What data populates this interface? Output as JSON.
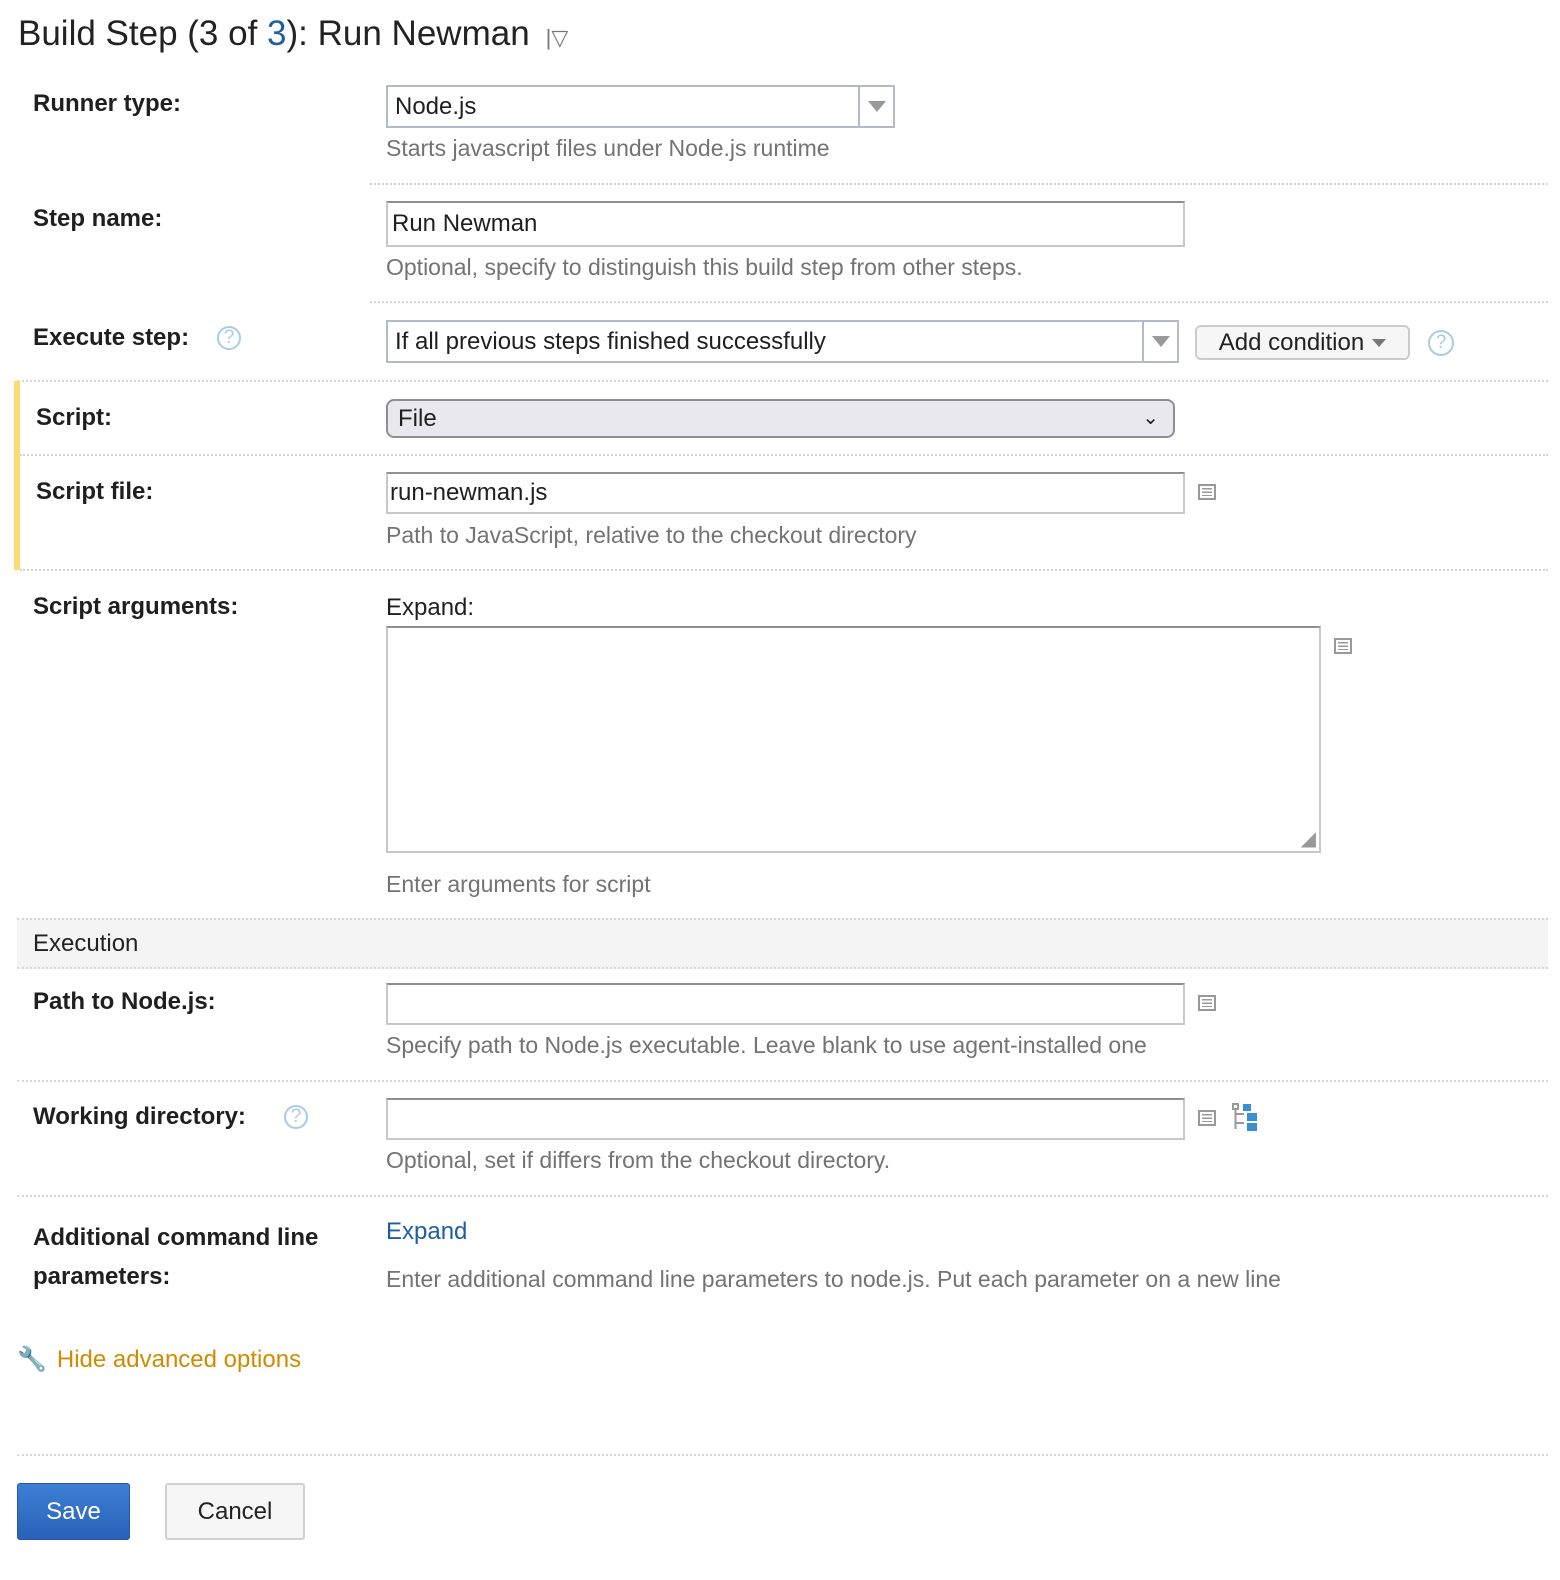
{
  "header": {
    "title_prefix": "Build Step (3 of ",
    "step_current": "3",
    "title_suffix": "): Run Newman",
    "menu_glyph": "|▽"
  },
  "runner_type": {
    "label": "Runner type:",
    "value": "Node.js",
    "description": "Starts javascript files under Node.js runtime"
  },
  "step_name": {
    "label": "Step name:",
    "value": "Run Newman",
    "description": "Optional, specify to distinguish this build step from other steps."
  },
  "execute_step": {
    "label": "Execute step:",
    "value": "If all previous steps finished successfully",
    "add_condition_label": "Add condition"
  },
  "script": {
    "label": "Script:",
    "value": "File"
  },
  "script_file": {
    "label": "Script file:",
    "value": "run-newman.js",
    "description": "Path to JavaScript, relative to the checkout directory"
  },
  "script_arguments": {
    "label": "Script arguments:",
    "expand_label": "Expand:",
    "value": "",
    "description": "Enter arguments for script"
  },
  "execution": {
    "section_title": "Execution"
  },
  "path_to_node": {
    "label": "Path to Node.js:",
    "value": "",
    "description": "Specify path to Node.js executable. Leave blank to use agent-installed one"
  },
  "working_directory": {
    "label": "Working directory:",
    "value": "",
    "description": "Optional, set if differs from the checkout directory."
  },
  "additional_params": {
    "label_line1": "Additional command line",
    "label_line2": "parameters:",
    "expand_link": "Expand",
    "description": "Enter additional command line parameters to node.js. Put each parameter on a new line"
  },
  "advanced": {
    "toggle_label": "Hide advanced options"
  },
  "actions": {
    "save_label": "Save",
    "cancel_label": "Cancel"
  },
  "colors": {
    "link": "#1f5fa0",
    "advanced": "#d08c00",
    "save_button": "#2f6fc9",
    "highlight_bar": "#fbdc74"
  }
}
